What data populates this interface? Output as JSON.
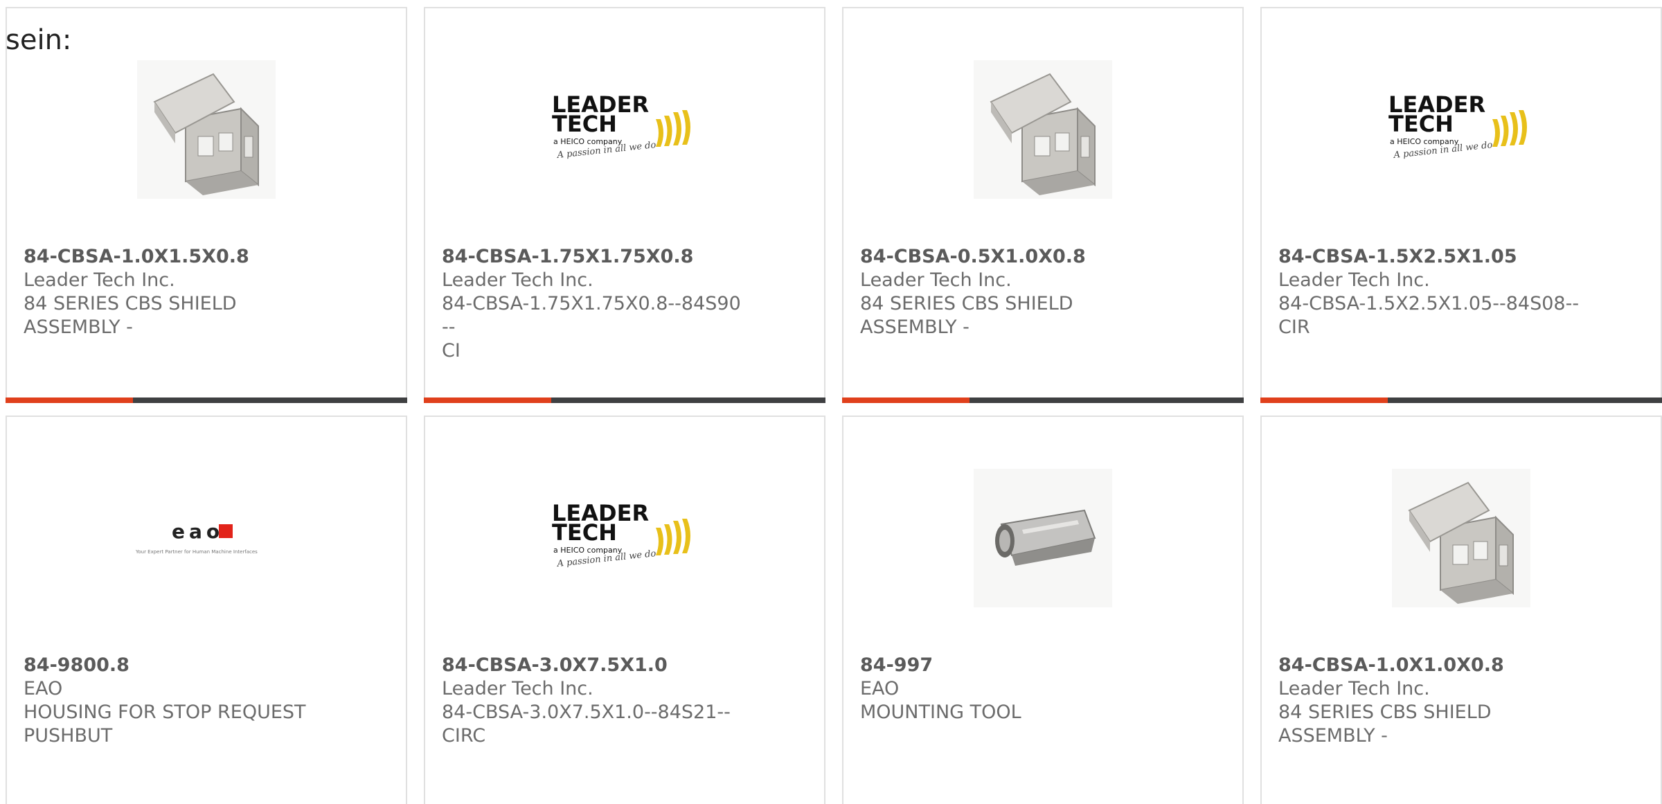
{
  "intro_text": "sein:",
  "colors": {
    "accent": "#e0401c",
    "bar": "#3f4042",
    "leadertech_yellow": "#e8c01a",
    "eao_red": "#e2231a"
  },
  "products": [
    {
      "part": "84-CBSA-1.0X1.5X0.8",
      "manufacturer": "Leader Tech Inc.",
      "desc_line1": "84 SERIES CBS SHIELD",
      "desc_line2": "ASSEMBLY -",
      "image_icon": "shield-cage-image"
    },
    {
      "part": "84-CBSA-1.75X1.75X0.8",
      "manufacturer": "Leader Tech Inc.",
      "desc_line1": "84-CBSA-1.75X1.75X0.8--84S90--",
      "desc_line2": "CI",
      "image_icon": "leader-tech-logo"
    },
    {
      "part": "84-CBSA-0.5X1.0X0.8",
      "manufacturer": "Leader Tech Inc.",
      "desc_line1": "84 SERIES CBS SHIELD",
      "desc_line2": "ASSEMBLY -",
      "image_icon": "shield-cage-image"
    },
    {
      "part": "84-CBSA-1.5X2.5X1.05",
      "manufacturer": "Leader Tech Inc.",
      "desc_line1": "84-CBSA-1.5X2.5X1.05--84S08--",
      "desc_line2": "CIR",
      "image_icon": "leader-tech-logo"
    },
    {
      "part": "84-9800.8",
      "manufacturer": "EAO",
      "desc_line1": "HOUSING FOR STOP REQUEST",
      "desc_line2": "PUSHBUT",
      "image_icon": "eao-logo"
    },
    {
      "part": "84-CBSA-3.0X7.5X1.0",
      "manufacturer": "Leader Tech Inc.",
      "desc_line1": "84-CBSA-3.0X7.5X1.0--84S21--",
      "desc_line2": "CIRC",
      "image_icon": "leader-tech-logo"
    },
    {
      "part": "84-997",
      "manufacturer": "EAO",
      "desc_line1": "MOUNTING TOOL",
      "desc_line2": "",
      "image_icon": "mounting-tool-image"
    },
    {
      "part": "84-CBSA-1.0X1.0X0.8",
      "manufacturer": "Leader Tech Inc.",
      "desc_line1": "84 SERIES CBS SHIELD",
      "desc_line2": "ASSEMBLY -",
      "image_icon": "shield-cage-image"
    }
  ],
  "logos": {
    "leader_tech_line1": "LEADER",
    "leader_tech_line2": "TECH",
    "leader_tech_tagline": "a HEICO company",
    "leader_tech_slogan": "A passion in all we do",
    "eao_wordmark": "eao",
    "eao_tagline": "Your Expert Partner for Human Machine Interfaces"
  }
}
